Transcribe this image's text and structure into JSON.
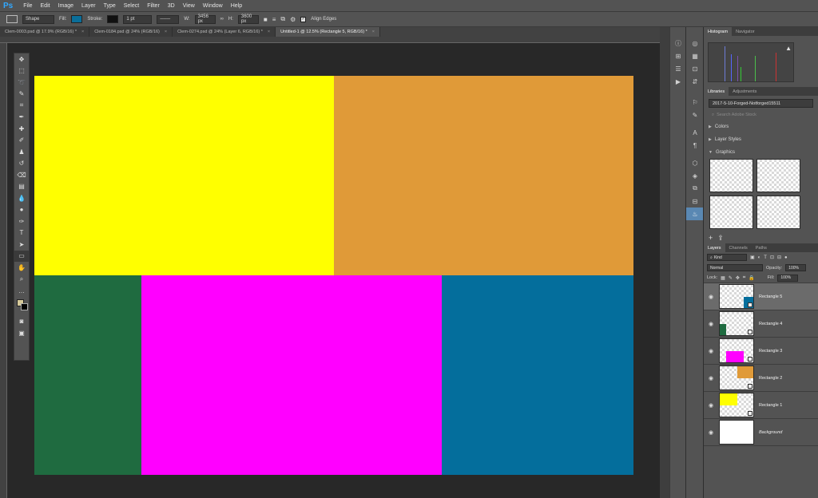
{
  "app": {
    "logo": "Ps"
  },
  "menu": [
    "File",
    "Edit",
    "Image",
    "Layer",
    "Type",
    "Select",
    "Filter",
    "3D",
    "View",
    "Window",
    "Help"
  ],
  "options": {
    "mode": "Shape",
    "fill_label": "Fill:",
    "stroke_label": "Stroke:",
    "stroke_width": "1 pt",
    "w_label": "W:",
    "w_value": "3456 px",
    "h_label": "H:",
    "h_value": "3600 px",
    "align_edges": "Align Edges",
    "fill_color": "#0a6e99"
  },
  "tabs": [
    {
      "label": "Clem-0003.psd @ 17.9% (RGB/16) *",
      "close": "×"
    },
    {
      "label": "Clem-0184.psd @ 24% (RGB/16)",
      "close": "×"
    },
    {
      "label": "Clem-0274.psd @ 24% (Layer 6, RGB/16) *",
      "close": "×"
    },
    {
      "label": "Untitled-1 @ 12.5% (Rectangle 5, RGB/16) *",
      "close": "×"
    }
  ],
  "canvas": {
    "colors": {
      "yellow": "#ffff00",
      "orange": "#e09a38",
      "green": "#1f6b40",
      "magenta": "#ff00ff",
      "blue": "#046e9c"
    }
  },
  "histogram": {
    "tabs": [
      "Histogram",
      "Navigator"
    ],
    "warning": "▲"
  },
  "libraries": {
    "tabs": [
      "Libraries",
      "Adjustments"
    ],
    "library_name": "2017-5-10-Forged-Notforged15511",
    "search_placeholder": "Search Adobe Stock",
    "sections": [
      "Colors",
      "Layer Styles",
      "Graphics"
    ]
  },
  "layers_panel": {
    "tabs": [
      "Layers",
      "Channels",
      "Paths"
    ],
    "kind": "Kind",
    "blend_mode": "Normal",
    "opacity_label": "Opacity:",
    "opacity": "100%",
    "lock_label": "Lock:",
    "fill_label": "Fill:",
    "fill": "100%",
    "layers": [
      {
        "name": "Rectangle 5",
        "selected": true,
        "color": "#046e9c"
      },
      {
        "name": "Rectangle 4",
        "selected": false,
        "color": "#1f6b40"
      },
      {
        "name": "Rectangle 3",
        "selected": false,
        "color": "#ff00ff"
      },
      {
        "name": "Rectangle 2",
        "selected": false,
        "color": "#e09a38"
      },
      {
        "name": "Rectangle 1",
        "selected": false,
        "color": "#ffff00"
      },
      {
        "name": "Background",
        "selected": false,
        "color": "#ffffff"
      }
    ]
  }
}
